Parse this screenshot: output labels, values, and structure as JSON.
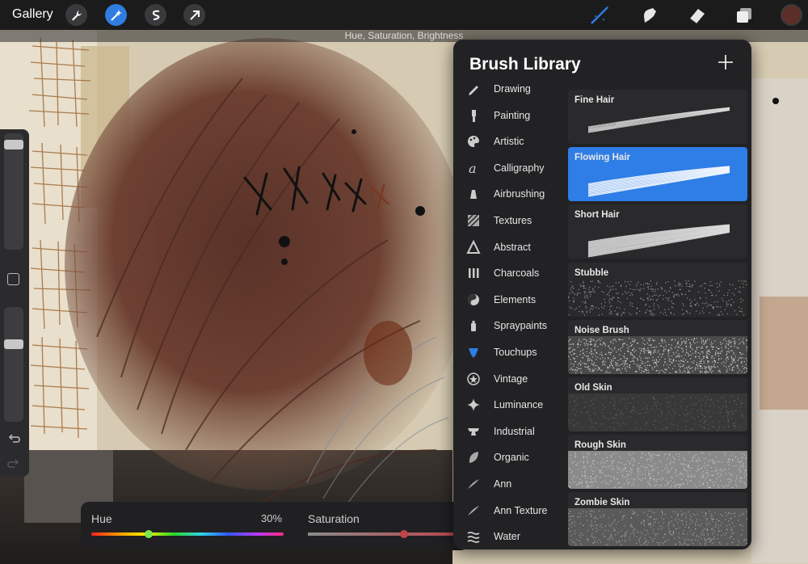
{
  "topbar": {
    "gallery_label": "Gallery",
    "left_tools": [
      {
        "name": "wrench-icon",
        "active": false
      },
      {
        "name": "magic-wand-icon",
        "active": true
      },
      {
        "name": "selection-icon",
        "active": false
      },
      {
        "name": "transform-arrow-icon",
        "active": false
      }
    ],
    "right_tools": [
      "brush-icon",
      "smudge-icon",
      "eraser-icon",
      "layers-icon"
    ],
    "active_color": "#5b2f27",
    "accent_color": "#2f7de1",
    "adjustment_label": "Hue, Saturation, Brightness"
  },
  "sidebar": {
    "size_slider_level": 0.05,
    "opacity_slider_level": 0.3,
    "icons": [
      "modify-square-icon",
      "undo-icon",
      "redo-icon"
    ]
  },
  "hsb": {
    "hue_label": "Hue",
    "hue_value": "30%",
    "hue_level": 0.3,
    "saturation_label": "Saturation",
    "saturation_level": 0.6
  },
  "brush_library": {
    "title": "Brush Library",
    "categories": [
      {
        "label": "Drawing",
        "icon": "pencil-icon"
      },
      {
        "label": "Painting",
        "icon": "paintbrush-icon"
      },
      {
        "label": "Artistic",
        "icon": "palette-icon"
      },
      {
        "label": "Calligraphy",
        "icon": "calligraphy-icon"
      },
      {
        "label": "Airbrushing",
        "icon": "airbrush-icon"
      },
      {
        "label": "Textures",
        "icon": "texture-icon"
      },
      {
        "label": "Abstract",
        "icon": "triangle-icon"
      },
      {
        "label": "Charcoals",
        "icon": "charcoal-icon"
      },
      {
        "label": "Elements",
        "icon": "yin-yang-icon"
      },
      {
        "label": "Spraypaints",
        "icon": "spraycan-icon"
      },
      {
        "label": "Touchups",
        "icon": "touchup-icon",
        "selected": true
      },
      {
        "label": "Vintage",
        "icon": "star-badge-icon"
      },
      {
        "label": "Luminance",
        "icon": "sparkle-icon"
      },
      {
        "label": "Industrial",
        "icon": "anvil-icon"
      },
      {
        "label": "Organic",
        "icon": "leaf-icon"
      },
      {
        "label": "Ann",
        "icon": "swoosh-icon"
      },
      {
        "label": "Ann Texture",
        "icon": "swoosh-icon"
      },
      {
        "label": "Water",
        "icon": "waves-icon"
      }
    ],
    "brushes": [
      {
        "name": "Fine Hair",
        "style": "hair-fine"
      },
      {
        "name": "Flowing Hair",
        "style": "hair-flow",
        "selected": true
      },
      {
        "name": "Short Hair",
        "style": "hair-short"
      },
      {
        "name": "Stubble",
        "style": "stubble"
      },
      {
        "name": "Noise Brush",
        "style": "noise"
      },
      {
        "name": "Old Skin",
        "style": "oldskin"
      },
      {
        "name": "Rough Skin",
        "style": "roughskin"
      },
      {
        "name": "Zombie Skin",
        "style": "zombieskin"
      }
    ]
  }
}
